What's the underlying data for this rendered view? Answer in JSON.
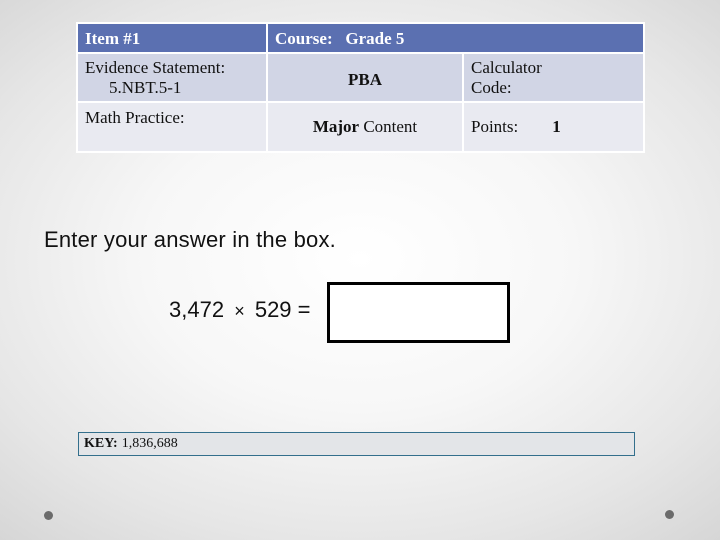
{
  "table": {
    "header": {
      "item": "Item #1",
      "course": "Course:   Grade 5"
    },
    "row2": {
      "evidence_label": "Evidence Statement:",
      "evidence_value": "5.NBT.5-1",
      "task_type": "PBA",
      "calculator_label_line1": "Calculator",
      "calculator_label_line2": "Code:"
    },
    "row3": {
      "math_practice_label": "Math Practice:",
      "content_bold": "Major",
      "content_rest": " Content",
      "points_label": "Points:",
      "points_value": "1"
    },
    "colors": {
      "header_bg": "#5b70b1",
      "row2_bg": "#d1d5e5",
      "row3_bg": "#e9eaf1"
    }
  },
  "prompt": "Enter your answer in the box.",
  "equation": {
    "left_operand": "3,472",
    "operator": "×",
    "right_operand": "529",
    "equals": "="
  },
  "answer_input": {
    "value": "",
    "placeholder": ""
  },
  "key": {
    "label": "KEY:",
    "value": "1,836,688"
  },
  "decorations": {
    "left_dot": "bullet-dot",
    "right_dot": "bullet-dot"
  }
}
